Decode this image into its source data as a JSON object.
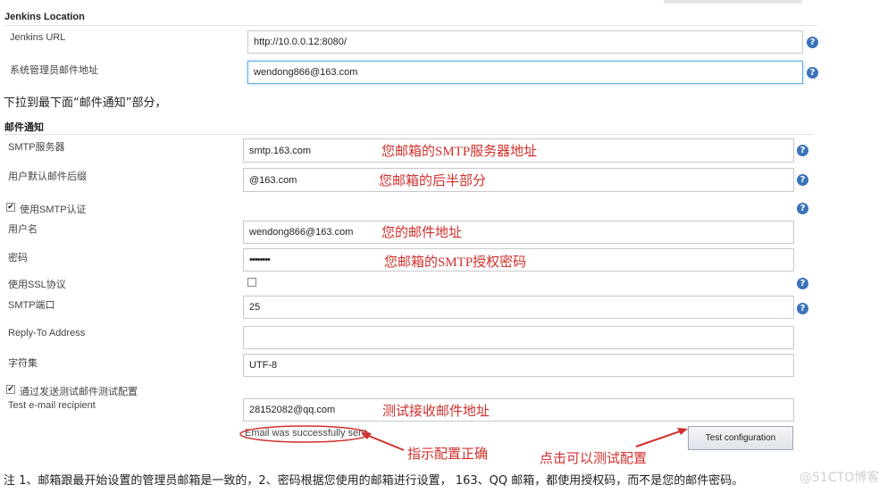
{
  "jenkins_location": {
    "title": "Jenkins Location",
    "url_label": "Jenkins URL",
    "url_value": "http://10.0.0.12:8080/",
    "admin_email_label": "系统管理员邮件地址",
    "admin_email_value": "wendong866@163.com"
  },
  "instruction": "下拉到最下面“邮件通知”部分，",
  "email_notification": {
    "title": "邮件通知",
    "smtp_server_label": "SMTP服务器",
    "smtp_server_value": "smtp.163.com",
    "default_suffix_label": "用户默认邮件后缀",
    "default_suffix_value": "@163.com",
    "use_smtp_auth_label": "使用SMTP认证",
    "username_label": "用户名",
    "username_value": "wendong866@163.com",
    "password_label": "密码",
    "password_value": "••••••••",
    "use_ssl_label": "使用SSL协议",
    "smtp_port_label": "SMTP端口",
    "smtp_port_value": "25",
    "reply_to_label": "Reply-To Address",
    "reply_to_value": "",
    "charset_label": "字符集",
    "charset_value": "UTF-8",
    "test_send_label": "通过发送测试邮件测试配置",
    "test_recipient_label": "Test e-mail recipient",
    "test_recipient_value": "28152082@qq.com",
    "success_message": "Email was successfully sent",
    "test_button": "Test configuration"
  },
  "annotations": {
    "smtp_server": "您邮箱的SMTP服务器地址",
    "suffix": "您邮箱的后半部分",
    "username": "您的邮件地址",
    "password": "您邮箱的SMTP授权密码",
    "recipient": "测试接收邮件地址",
    "success": "指示配置正确",
    "test_button": "点击可以测试配置"
  },
  "footer_note": "注 1、邮箱跟最开始设置的管理员邮箱是一致的，2、密码根据您使用的邮箱进行设置， 163、QQ 邮箱，都使用授权码，而不是您的邮件密码。",
  "watermark": "@51CTO博客",
  "colors": {
    "annotation": "#d0302c",
    "help_icon": "#3b73b9",
    "focus": "#66afe9"
  },
  "help_glyph": "?",
  "checked_glyph": "✔"
}
